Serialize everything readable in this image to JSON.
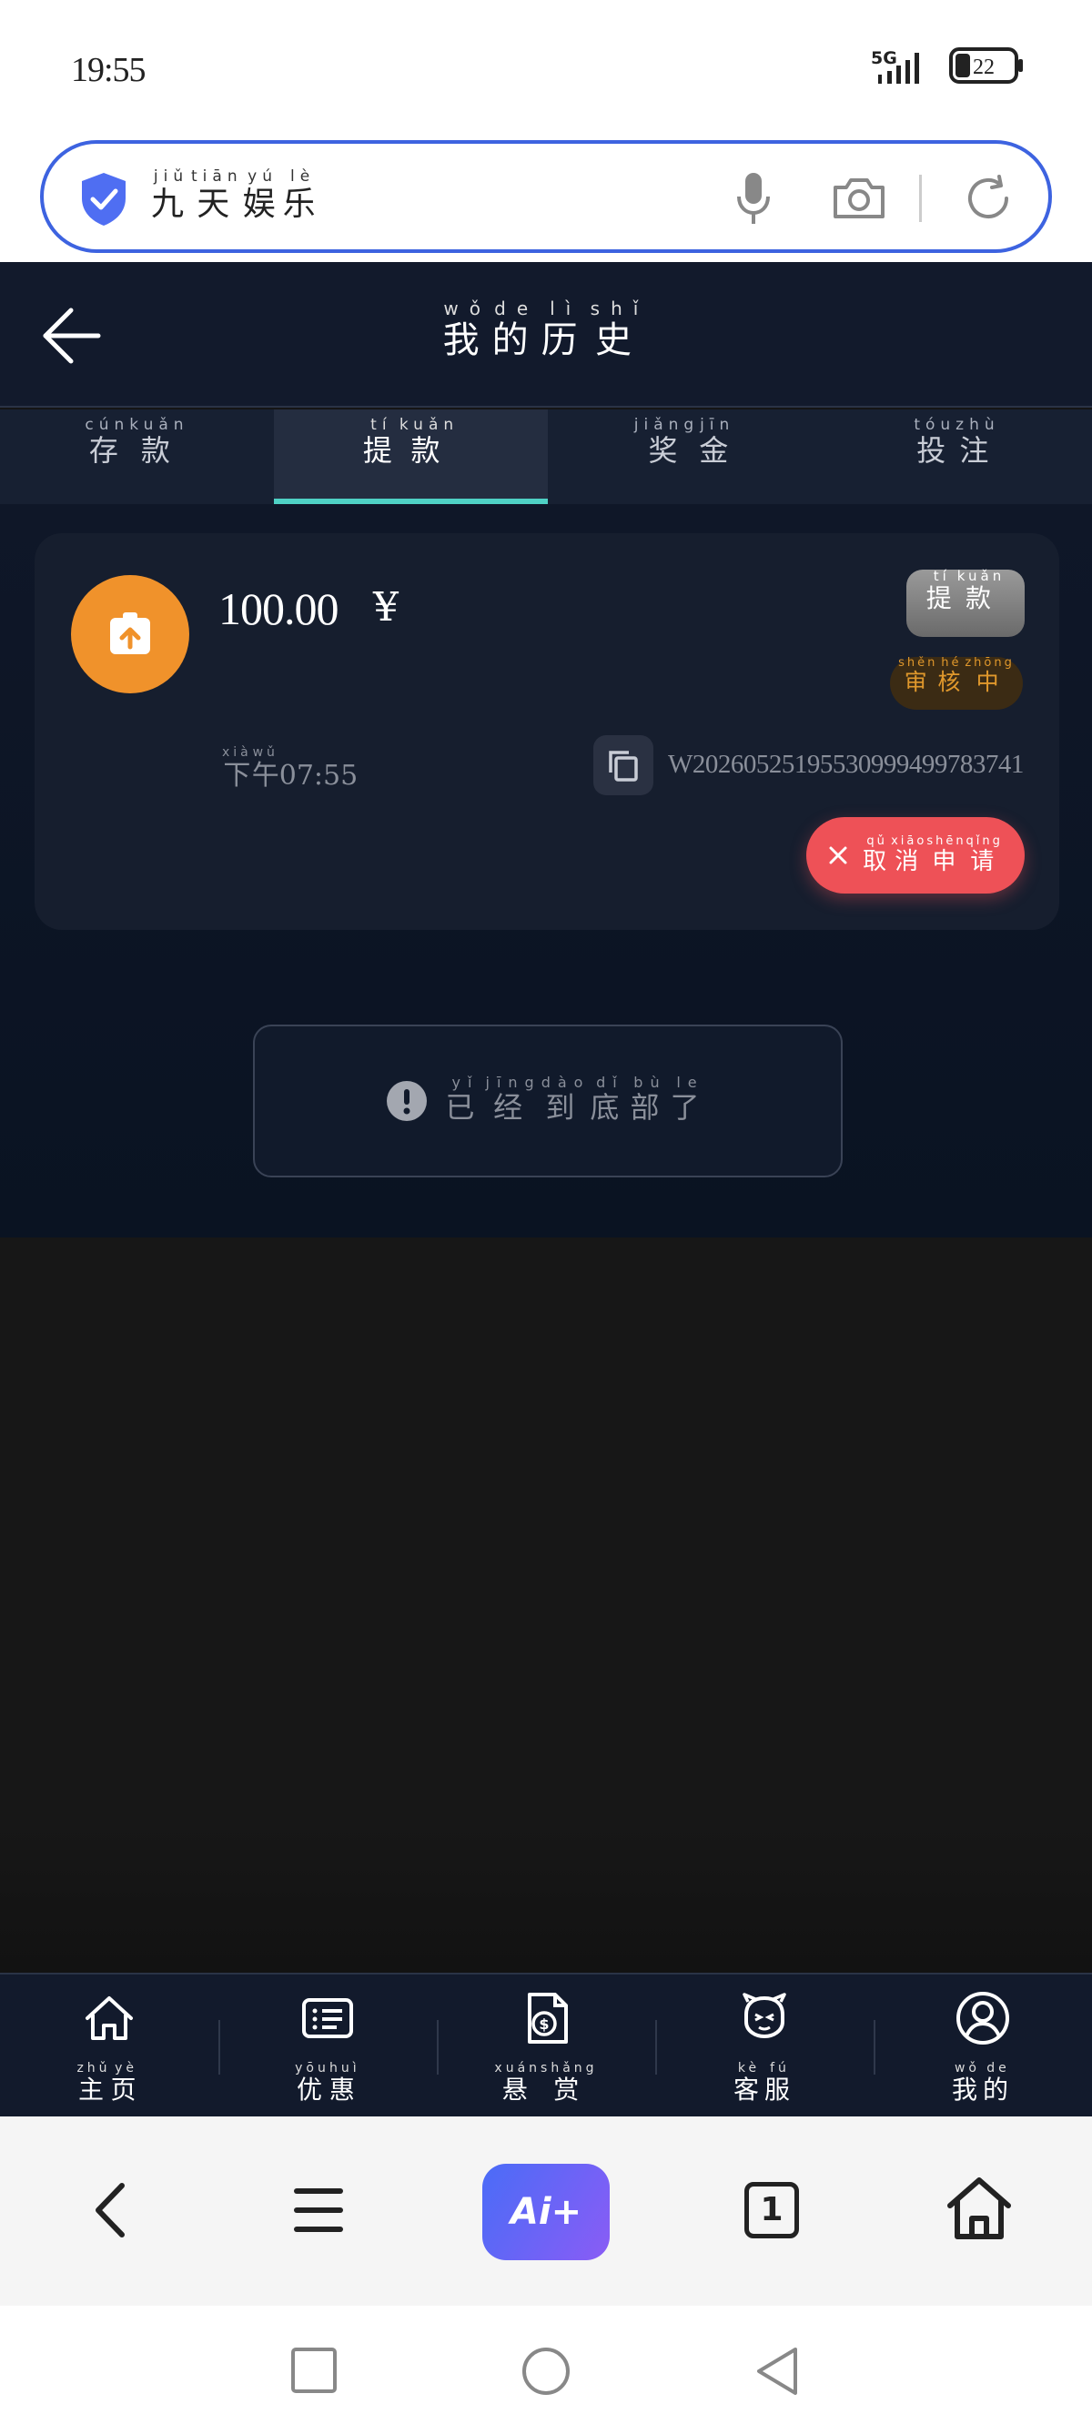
{
  "status_bar": {
    "time": "19:55",
    "network": "5G",
    "battery": "22"
  },
  "address_bar": {
    "site_chars": [
      {
        "char": "九",
        "pinyin": "jiǔ"
      },
      {
        "char": "天",
        "pinyin": "tiān"
      },
      {
        "char": "娱",
        "pinyin": "yú"
      },
      {
        "char": "乐",
        "pinyin": "lè"
      }
    ]
  },
  "header": {
    "title_chars": [
      {
        "char": "我",
        "pinyin": "wǒ"
      },
      {
        "char": "的",
        "pinyin": "de"
      },
      {
        "char": "历",
        "pinyin": "lì"
      },
      {
        "char": "史",
        "pinyin": "shǐ"
      }
    ]
  },
  "tabs": [
    {
      "chars": [
        {
          "char": "存",
          "pinyin": "cún"
        },
        {
          "char": "款",
          "pinyin": "kuǎn"
        }
      ],
      "active": false
    },
    {
      "chars": [
        {
          "char": "提",
          "pinyin": "tí"
        },
        {
          "char": "款",
          "pinyin": "kuǎn"
        }
      ],
      "active": true
    },
    {
      "chars": [
        {
          "char": "奖",
          "pinyin": "jiǎng"
        },
        {
          "char": "金",
          "pinyin": "jīn"
        }
      ],
      "active": false
    },
    {
      "chars": [
        {
          "char": "投",
          "pinyin": "tóu"
        },
        {
          "char": "注",
          "pinyin": "zhù"
        }
      ],
      "active": false
    }
  ],
  "record": {
    "amount": "100.00",
    "currency": "¥",
    "type_chars": [
      {
        "char": "提",
        "pinyin": "tí"
      },
      {
        "char": "款",
        "pinyin": "kuǎn"
      }
    ],
    "status_chars": [
      {
        "char": "审",
        "pinyin": "shěn"
      },
      {
        "char": "核",
        "pinyin": "hé"
      },
      {
        "char": "中",
        "pinyin": "zhōng"
      }
    ],
    "time_chars": [
      {
        "char": "下",
        "pinyin": "xià"
      },
      {
        "char": "午",
        "pinyin": "wǔ"
      }
    ],
    "time_value": "07:55",
    "order_id": "W2026052519553099949978374​1",
    "cancel_chars": [
      {
        "char": "取",
        "pinyin": "qǔ"
      },
      {
        "char": "消",
        "pinyin": "xiāo"
      },
      {
        "char": "申",
        "pinyin": "shēn"
      },
      {
        "char": "请",
        "pinyin": "qǐng"
      }
    ]
  },
  "end_message_chars": [
    {
      "char": "已",
      "pinyin": "yǐ"
    },
    {
      "char": "经",
      "pinyin": "jīng"
    },
    {
      "char": "到",
      "pinyin": "dào"
    },
    {
      "char": "底",
      "pinyin": "dǐ"
    },
    {
      "char": "部",
      "pinyin": "bù"
    },
    {
      "char": "了",
      "pinyin": "le"
    }
  ],
  "bottom_nav": [
    {
      "icon": "home-icon",
      "chars": [
        {
          "char": "主",
          "pinyin": "zhǔ"
        },
        {
          "char": "页",
          "pinyin": "yè"
        }
      ]
    },
    {
      "icon": "promo-list-icon",
      "chars": [
        {
          "char": "优",
          "pinyin": "yōu"
        },
        {
          "char": "惠",
          "pinyin": "huì"
        }
      ]
    },
    {
      "icon": "reward-document-icon",
      "chars": [
        {
          "char": "悬",
          "pinyin": "xuán"
        },
        {
          "char": "赏",
          "pinyin": "shǎng"
        }
      ]
    },
    {
      "icon": "customer-service-icon",
      "chars": [
        {
          "char": "客",
          "pinyin": "kè"
        },
        {
          "char": "服",
          "pinyin": "fú"
        }
      ]
    },
    {
      "icon": "profile-icon",
      "chars": [
        {
          "char": "我",
          "pinyin": "wǒ"
        },
        {
          "char": "的",
          "pinyin": "de"
        }
      ]
    }
  ],
  "browser_toolbar": {
    "ai_label": "Ai+",
    "tab_count": "1"
  },
  "colors": {
    "accent_tab_underline": "#4fd1c5",
    "avatar_orange": "#f0922b",
    "cancel_red": "#ee5157",
    "pending_amber": "#e0982c",
    "address_border_blue": "#3d63e0"
  }
}
